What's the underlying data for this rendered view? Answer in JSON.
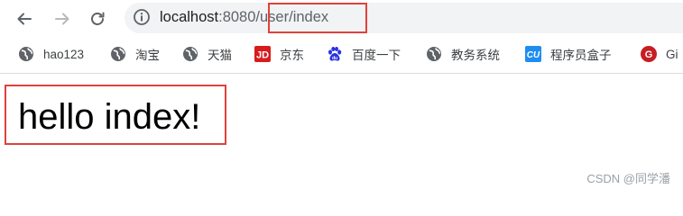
{
  "browser": {
    "address": {
      "host": "localhost",
      "port": ":8080",
      "path": "/user/index"
    }
  },
  "bookmarks": [
    {
      "label": "hao123",
      "icon": "globe-icon"
    },
    {
      "label": "淘宝",
      "icon": "globe-icon"
    },
    {
      "label": "天猫",
      "icon": "globe-icon"
    },
    {
      "label": "京东",
      "icon": "jd-icon",
      "icon_text": "JD"
    },
    {
      "label": "百度一下",
      "icon": "baidu-paw-icon"
    },
    {
      "label": "教务系统",
      "icon": "globe-icon"
    },
    {
      "label": "程序员盒子",
      "icon": "cu-icon",
      "icon_text": "CU"
    },
    {
      "label": "Gi",
      "icon": "gitee-icon",
      "icon_text": "G"
    }
  ],
  "page": {
    "heading": "hello index!"
  },
  "watermark": "CSDN @同学潘",
  "colors": {
    "highlight": "#e0423b",
    "jd": "#d71c1e",
    "cu": "#1f8df0",
    "baidu": "#2932e1",
    "gitee": "#c71d23"
  }
}
